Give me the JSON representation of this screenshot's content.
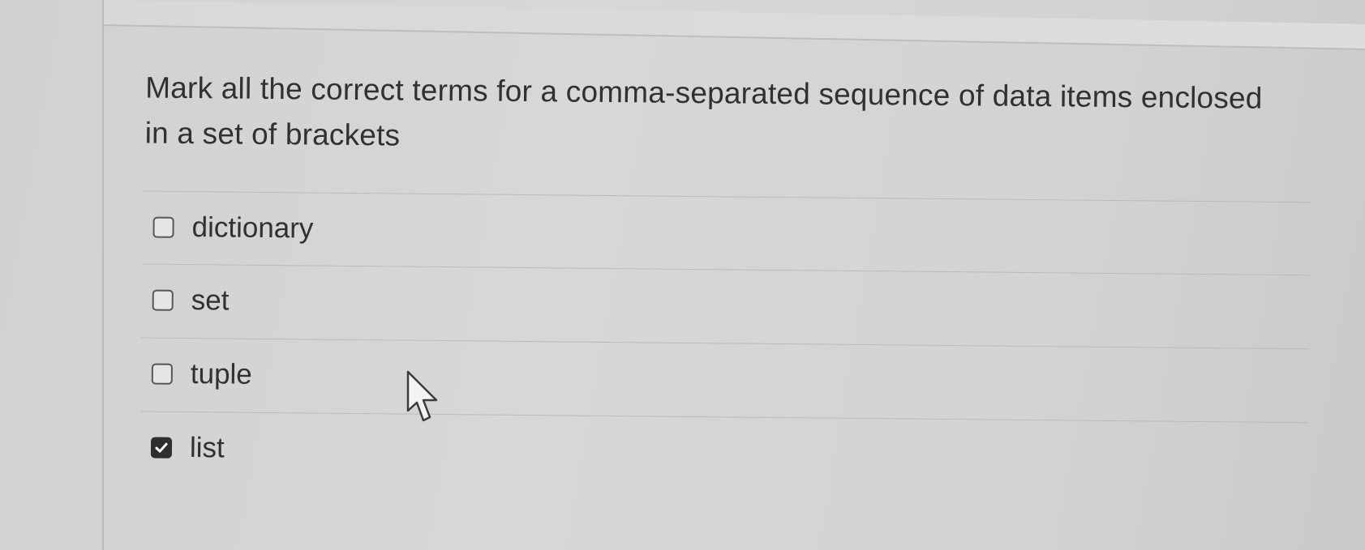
{
  "question": {
    "text": "Mark all the correct terms for a comma-separated sequence of data items enclosed in a set of brackets"
  },
  "answers": [
    {
      "label": "dictionary",
      "checked": false
    },
    {
      "label": "set",
      "checked": false
    },
    {
      "label": "tuple",
      "checked": false
    },
    {
      "label": "list",
      "checked": true
    }
  ],
  "icons": {
    "checkbox": "checkbox-icon",
    "checkmark": "checkmark-icon",
    "cursor": "mouse-pointer-icon"
  },
  "colors": {
    "text": "#2f3132",
    "checked_fill": "#2c2e30",
    "background": "#d4d6d4"
  }
}
